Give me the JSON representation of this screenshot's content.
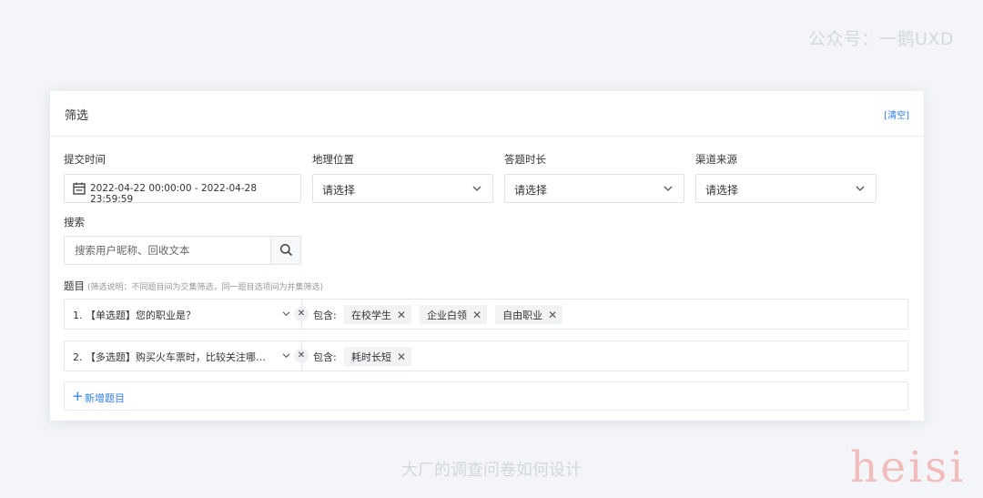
{
  "watermark": {
    "top": "公众号：一鹅UXD",
    "bottom_caption": "大厂的调查问卷如何设计",
    "corner": "heisi"
  },
  "panel": {
    "title": "筛选",
    "clear_label": "[清空]"
  },
  "filters": {
    "submit_time": {
      "label": "提交时间",
      "value": "2022-04-22 00:00:00 - 2022-04-28 23:59:59"
    },
    "location": {
      "label": "地理位置",
      "value": "请选择"
    },
    "duration": {
      "label": "答题时长",
      "value": "请选择"
    },
    "channel": {
      "label": "渠道来源",
      "value": "请选择"
    }
  },
  "search": {
    "label": "搜索",
    "placeholder": "搜索用户昵称、回收文本"
  },
  "questions": {
    "label": "题目",
    "note": "(筛选说明：不同题目间为交集筛选，同一题目选项间为并集筛选)",
    "contains_label": "包含:",
    "items": [
      {
        "text": "1. 【单选题】您的职业是？",
        "tags": [
          "在校学生",
          "企业白领",
          "自由职业"
        ]
      },
      {
        "text": "2. 【多选题】购买火车票时，比较关注哪…",
        "tags": [
          "耗时长短"
        ]
      }
    ],
    "add_label": "新增题目"
  },
  "colors": {
    "accent": "#2f7ee6",
    "background": "#f3f5f8",
    "tag_bg": "#f2f3f5",
    "border": "#dfe2e8"
  },
  "icons": [
    "calendar-icon",
    "chevron-down-icon",
    "search-icon",
    "close-icon",
    "plus-icon"
  ]
}
